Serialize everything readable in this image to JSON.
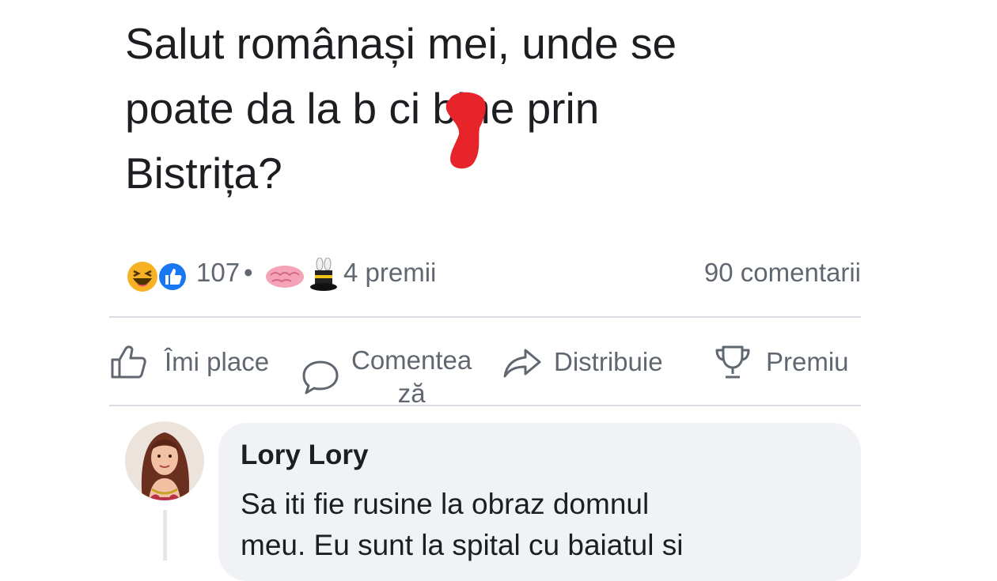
{
  "post": {
    "lines": [
      "Salut românași mei, unde se",
      "poate da la b  ci bine prin",
      "Bistrița?"
    ]
  },
  "stats": {
    "reactions_count": "107",
    "separator": "•",
    "awards": "4 premii",
    "comments": "90 comentarii"
  },
  "actions": {
    "like": "Îmi place",
    "comment_line1": "Comentea",
    "comment_line2": "ză",
    "share": "Distribuie",
    "award": "Premiu"
  },
  "comment": {
    "author": "Lory Lory",
    "lines": [
      "Sa iti fie rusine la obraz domnul",
      "meu. Eu sunt la spital cu baiatul si"
    ]
  },
  "colors": {
    "text": "#1c1e21",
    "secondary": "#606770",
    "bubble": "#f0f2f5",
    "like_blue": "#1877f2",
    "haha_yellow": "#f7b125",
    "redaction": "#e8242b"
  },
  "icons": [
    "haha-reaction-icon",
    "like-reaction-icon",
    "brain-award-icon",
    "magic-hat-award-icon",
    "thumb-up-icon",
    "speech-bubble-icon",
    "share-arrow-icon",
    "trophy-icon"
  ]
}
